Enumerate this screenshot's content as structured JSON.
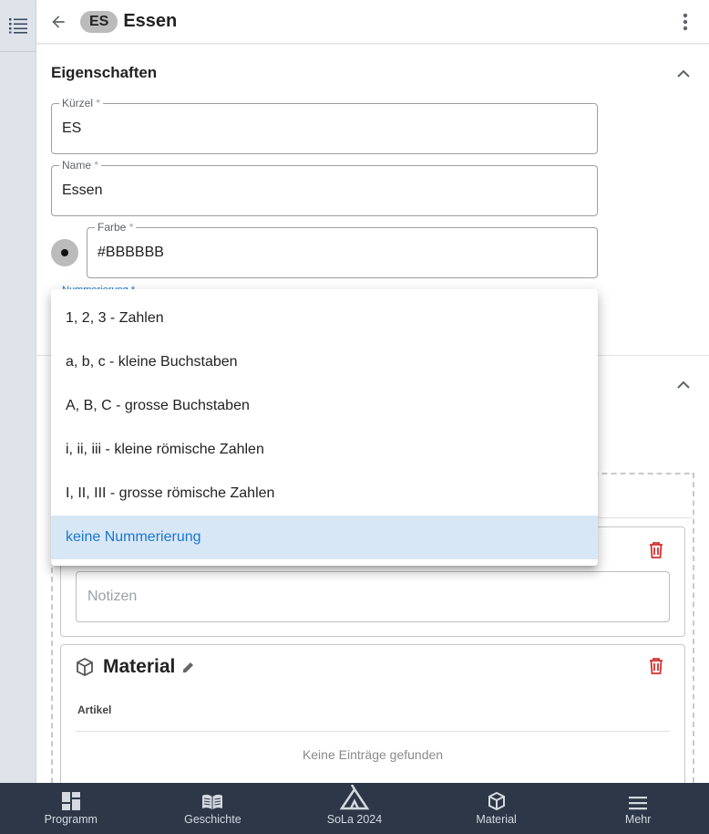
{
  "header": {
    "chip": "ES",
    "title": "Essen"
  },
  "properties": {
    "title": "Eigenschaften",
    "fields": {
      "kuerzel": {
        "label": "Kürzel",
        "required": "*",
        "value": "ES"
      },
      "name": {
        "label": "Name",
        "required": "*",
        "value": "Essen"
      },
      "farbe": {
        "label": "Farbe",
        "required": "*",
        "value": "#BBBBBB"
      },
      "nummerierung": {
        "label": "Nummerierung",
        "required": "*"
      }
    },
    "swatch_color": "#BBBBBB"
  },
  "dropdown": {
    "options": [
      {
        "label": "1, 2, 3 - Zahlen"
      },
      {
        "label": "a, b, c - kleine Buchstaben"
      },
      {
        "label": "A, B, C - grosse Buchstaben"
      },
      {
        "label": "i, ii, iii - kleine römische Zahlen"
      },
      {
        "label": "I, II, III - grosse römische Zahlen"
      },
      {
        "label": "keine Nummerierung"
      }
    ],
    "selected_index": 5
  },
  "notes_card": {
    "placeholder": "Notizen"
  },
  "material_card": {
    "title": "Material",
    "column_header": "Artikel",
    "empty_text": "Keine Einträge gefunden"
  },
  "bottom_nav": {
    "items": [
      {
        "label": "Programm",
        "icon": "dashboard-icon"
      },
      {
        "label": "Geschichte",
        "icon": "book-open-icon"
      },
      {
        "label": "SoLa 2024",
        "icon": "tent-icon"
      },
      {
        "label": "Material",
        "icon": "package-icon"
      },
      {
        "label": "Mehr",
        "icon": "menu-icon"
      }
    ]
  },
  "colors": {
    "accent": "#1976d2",
    "selected_bg": "#d8e7f6",
    "delete": "#d32f2f",
    "nav_bg": "#2d3748"
  }
}
